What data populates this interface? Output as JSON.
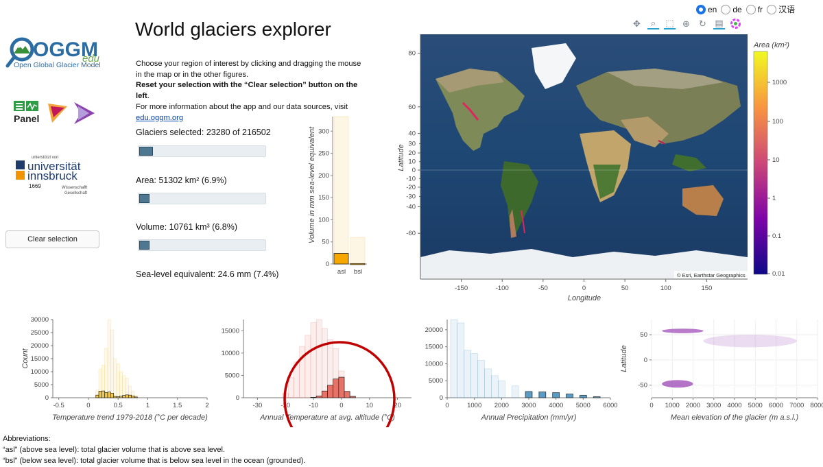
{
  "language": {
    "options": [
      "en",
      "de",
      "fr",
      "汉语"
    ],
    "selected": "en"
  },
  "logos": {
    "oggm_word": "OGGM",
    "oggm_edu": "edu",
    "oggm_sub": "Open Global Glacier Model",
    "panel_word": "Panel",
    "uni_small": "unterstützt von",
    "uni_line1": "universität",
    "uni_line2": "innsbruck",
    "uni_year": "1669",
    "uni_ws1": "Wissenschafft",
    "uni_ws2": "Gesellschaft"
  },
  "title": "World glaciers explorer",
  "intro": {
    "line1": "Choose your region of interest by clicking and dragging the mouse in the map or in the other figures.",
    "bold": "Reset your selection with the “Clear selection” button on the left",
    "bold_end": ".",
    "line3": "For more information about the app and our data sources, visit",
    "link": "edu.oggm.org"
  },
  "clear_button": "Clear selection",
  "stats": {
    "glaciers": "Glaciers selected: 23280 of 216502",
    "glaciers_frac": 0.108,
    "area": "Area: 51302 km² (6.9%)",
    "area_frac": 0.069,
    "volume": "Volume: 10761 km³ (6.8%)",
    "volume_frac": 0.068,
    "slr": "Sea-level equivalent: 24.6 mm (7.4%)"
  },
  "toolbar_icons": [
    "pan-icon",
    "box-zoom-icon",
    "box-select-icon",
    "wheel-zoom-icon",
    "reset-icon",
    "hover-icon",
    "bokeh-logo-icon"
  ],
  "colors": {
    "asl": "#f6a800",
    "map_glacier": "#ff0066",
    "temp": "#e57368",
    "precip": "#5b9bc4",
    "elev": "#a050b8",
    "trend": "#f2c94c",
    "annotation": "#c00000"
  },
  "volume_chart": {
    "ylabel": "Volume in mm sea-level equivalent",
    "categories": [
      "asl",
      "bsl"
    ],
    "total": [
      333,
      60
    ],
    "selected": [
      24,
      1
    ],
    "yticks": [
      "0",
      "50",
      "100",
      "150",
      "200",
      "250",
      "300"
    ]
  },
  "map": {
    "xlabel": "Longitude",
    "ylabel": "Latitude",
    "xticks": [
      "-150",
      "-100",
      "-50",
      "0",
      "50",
      "100",
      "150"
    ],
    "yticks": [
      "80",
      "60",
      "40",
      "20",
      "0",
      "-20",
      "-40",
      "-60"
    ],
    "extra_yticks": [
      "30",
      "10",
      "-10",
      "-30"
    ],
    "attribution": "© Esri, Earthstar Geographics",
    "colorbar_title": "Area (km²)",
    "colorbar_ticks": [
      "1000",
      "100",
      "10",
      "1",
      "0.1",
      "0.01"
    ]
  },
  "chart_data": [
    {
      "type": "bar",
      "title": "",
      "xlabel": "Temperature trend 1979-2018 (°C per decade)",
      "ylabel": "Count",
      "xticks": [
        "-0.5",
        "0",
        "0.5",
        "1",
        "1.5",
        "2"
      ],
      "yticks": [
        "0",
        "5000",
        "10000",
        "15000",
        "20000",
        "25000",
        "30000"
      ],
      "ylim": [
        0,
        30000
      ],
      "x": [
        0.15,
        0.2,
        0.25,
        0.3,
        0.35,
        0.4,
        0.45,
        0.5,
        0.55,
        0.6,
        0.65,
        0.7,
        0.75,
        0.8
      ],
      "series": [
        {
          "name": "all",
          "values": [
            3000,
            11000,
            12500,
            19000,
            30000,
            26000,
            15000,
            13000,
            10000,
            8500,
            7500,
            4500,
            2500,
            1000
          ]
        },
        {
          "name": "selected",
          "values": [
            1000,
            2500,
            2600,
            2000,
            2200,
            1700,
            500,
            400,
            600,
            900,
            1100,
            1000,
            700,
            300
          ]
        }
      ]
    },
    {
      "type": "bar",
      "title": "",
      "xlabel": "Annual Temperature at avg. altitude (°C)",
      "ylabel": "",
      "xticks": [
        "-30",
        "-20",
        "-10",
        "0",
        "10",
        "20"
      ],
      "yticks": [
        "0",
        "5000",
        "10000",
        "15000"
      ],
      "ylim": [
        0,
        17500
      ],
      "x": [
        -20,
        -18,
        -16,
        -14,
        -12,
        -10,
        -8,
        -6,
        -4,
        -2,
        0,
        2,
        4
      ],
      "series": [
        {
          "name": "all",
          "values": [
            1000,
            4500,
            8000,
            11500,
            14000,
            16800,
            18000,
            15500,
            13000,
            11000,
            6000,
            1500,
            400
          ]
        },
        {
          "name": "selected",
          "values": [
            0,
            0,
            0,
            0,
            0,
            100,
            400,
            1500,
            2800,
            4200,
            4600,
            1400,
            300
          ]
        }
      ]
    },
    {
      "type": "bar",
      "title": "",
      "xlabel": "Annual Precipitation (mm/yr)",
      "ylabel": "",
      "xticks": [
        "0",
        "1000",
        "2000",
        "3000",
        "4000",
        "5000",
        "6000"
      ],
      "yticks": [
        "0",
        "5000",
        "10000",
        "15000",
        "20000"
      ],
      "ylim": [
        0,
        23000
      ],
      "x": [
        250,
        500,
        750,
        1000,
        1250,
        1500,
        1750,
        2000,
        2500,
        3000,
        3500,
        4000,
        4500,
        5000,
        5500
      ],
      "series": [
        {
          "name": "all",
          "values": [
            24000,
            22000,
            14000,
            13000,
            11000,
            8500,
            6500,
            5000,
            3500,
            2000,
            1800,
            1400,
            1100,
            800,
            200
          ]
        },
        {
          "name": "selected",
          "values": [
            0,
            0,
            0,
            0,
            0,
            0,
            0,
            0,
            0,
            1800,
            1700,
            1500,
            1100,
            700,
            300
          ]
        }
      ]
    },
    {
      "type": "heatmap",
      "title": "",
      "xlabel": "Mean elevation of the glacier (m a.s.l.)",
      "ylabel": "Latitude",
      "xticks": [
        "0",
        "1000",
        "2000",
        "3000",
        "4000",
        "5000",
        "6000",
        "7000",
        "8000"
      ],
      "yticks": [
        "50",
        "0",
        "-50"
      ],
      "clusters": [
        {
          "x": [
            500,
            2500
          ],
          "y": [
            53,
            62
          ]
        },
        {
          "x": [
            2500,
            7000
          ],
          "y": [
            25,
            50
          ]
        },
        {
          "x": [
            500,
            2000
          ],
          "y": [
            -55,
            -40
          ]
        }
      ]
    }
  ],
  "annotation": "red-circle-highlight",
  "abbreviations": {
    "header": "Abbreviations:",
    "asl": "“asl” (above sea level): total glacier volume that is above sea level.",
    "bsl": "“bsl” (below sea level): total glacier volume that is below sea level in the ocean (grounded)."
  }
}
